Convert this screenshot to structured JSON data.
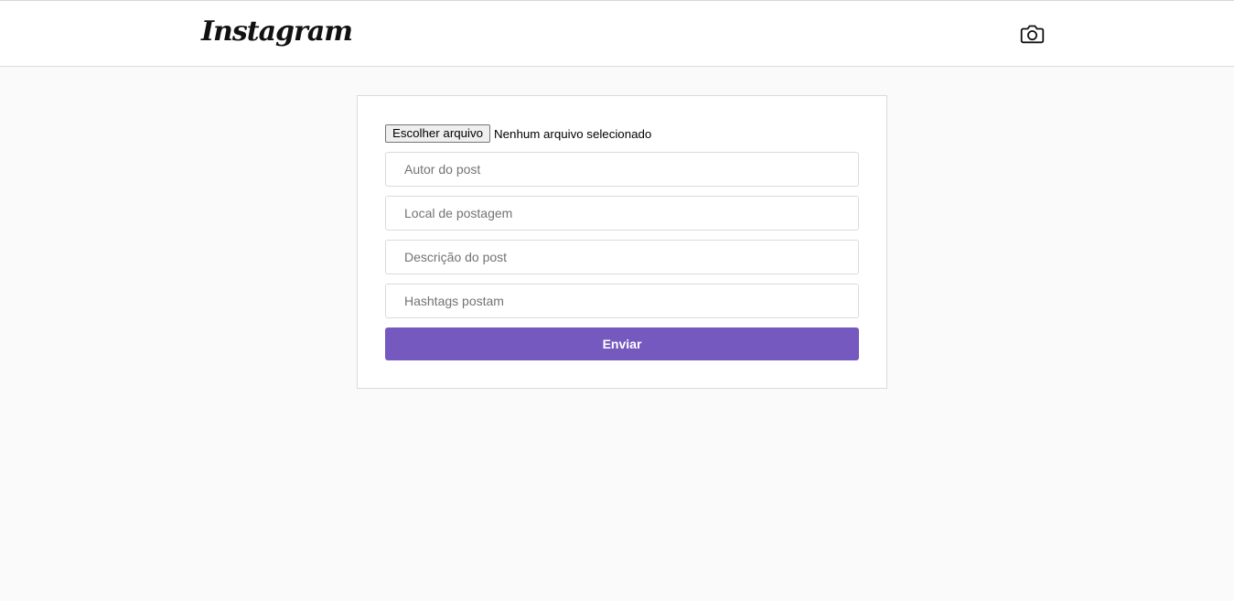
{
  "header": {
    "logo_text": "Instagram",
    "camera_icon": "camera-icon"
  },
  "form": {
    "file_button_label": "Escolher arquivo",
    "file_status": "Nenhum arquivo selecionado",
    "fields": {
      "author_placeholder": "Autor do post",
      "location_placeholder": "Local de postagem",
      "description_placeholder": "Descrição do post",
      "hashtags_placeholder": "Hashtags postam"
    },
    "submit_label": "Enviar"
  },
  "colors": {
    "accent": "#7559bf",
    "background": "#fafafa",
    "border": "#dbdbdb"
  }
}
